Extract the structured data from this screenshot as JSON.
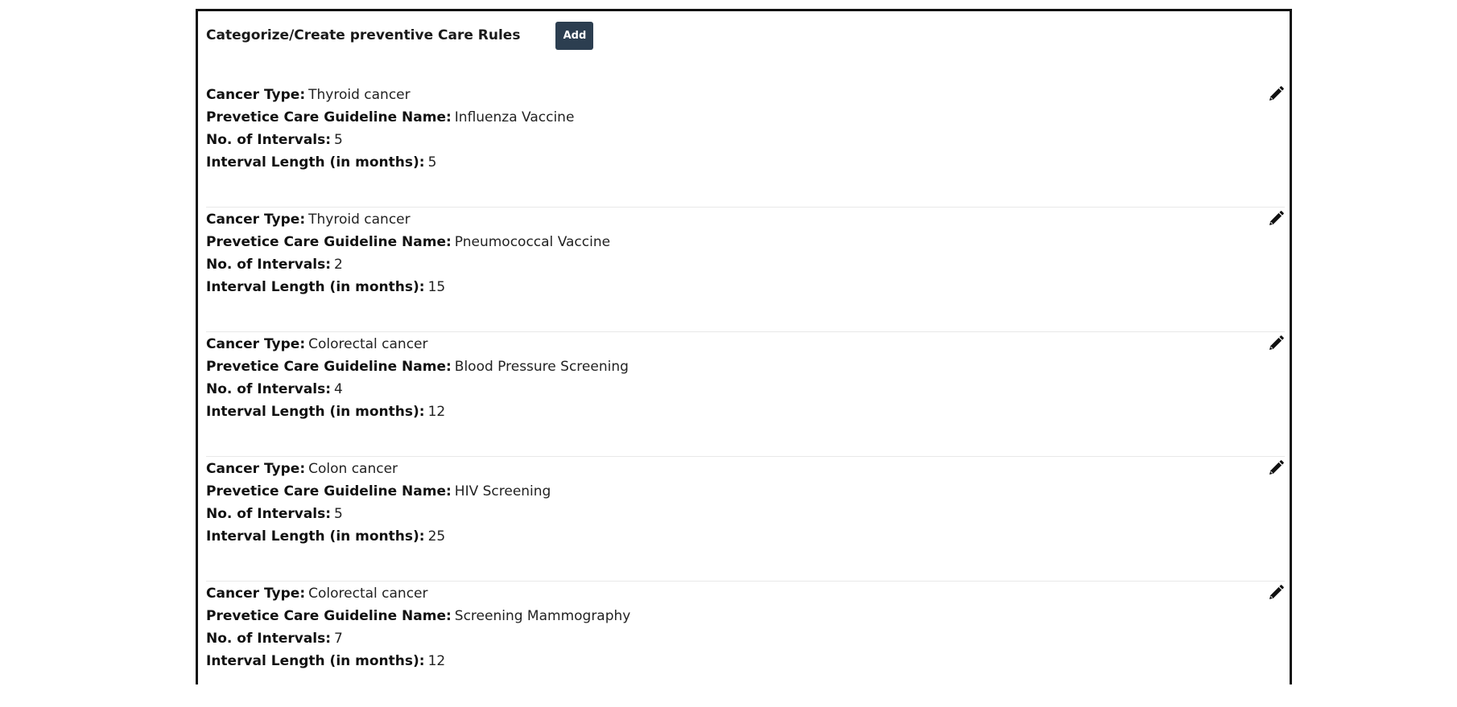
{
  "header": {
    "title": "Categorize/Create preventive Care Rules",
    "add_label": "Add"
  },
  "labels": {
    "cancer_type": "Cancer Type:",
    "guideline_name": "Prevetice Care Guideline Name:",
    "num_intervals": "No. of Intervals:",
    "interval_length": "Interval Length (in months):"
  },
  "icons": {
    "edit": "pencil-icon"
  },
  "rules": [
    {
      "cancer_type": "Thyroid cancer",
      "guideline_name": "Influenza Vaccine",
      "num_intervals": "5",
      "interval_length": "5"
    },
    {
      "cancer_type": "Thyroid cancer",
      "guideline_name": "Pneumococcal Vaccine",
      "num_intervals": "2",
      "interval_length": "15"
    },
    {
      "cancer_type": "Colorectal cancer",
      "guideline_name": "Blood Pressure Screening",
      "num_intervals": "4",
      "interval_length": "12"
    },
    {
      "cancer_type": "Colon cancer",
      "guideline_name": "HIV Screening",
      "num_intervals": "5",
      "interval_length": "25"
    },
    {
      "cancer_type": "Colorectal cancer",
      "guideline_name": "Screening Mammography",
      "num_intervals": "7",
      "interval_length": "12"
    }
  ]
}
